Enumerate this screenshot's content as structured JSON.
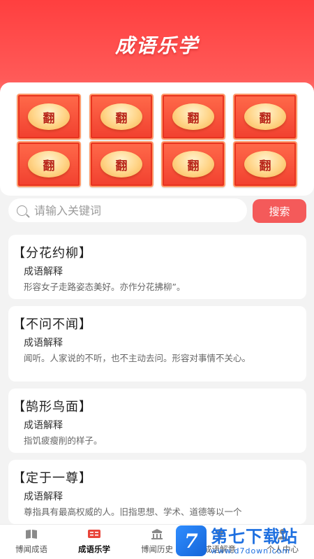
{
  "header": {
    "title": "成语乐学"
  },
  "tiles": [
    {
      "char": "翻"
    },
    {
      "char": "翻"
    },
    {
      "char": "翻"
    },
    {
      "char": "翻"
    },
    {
      "char": "翻"
    },
    {
      "char": "翻"
    },
    {
      "char": "翻"
    },
    {
      "char": "翻"
    }
  ],
  "search": {
    "placeholder": "请输入关键词",
    "value": "",
    "button_label": "搜索"
  },
  "cards": [
    {
      "title": "【分花约柳】",
      "subtitle": "成语解释",
      "desc": "形容女子走路姿态美好。亦作分花拂柳”。"
    },
    {
      "title": "【不问不闻】",
      "subtitle": "成语解释",
      "desc": "闻听。人家说的不听，也不主动去问。形容对事情不关心。"
    },
    {
      "title": "【鹄形鸟面】",
      "subtitle": "成语解释",
      "desc": "指饥疲瘦削的样子。"
    },
    {
      "title": "【定于一尊】",
      "subtitle": "成语解释",
      "desc": "尊指具有最高权威的人。旧指思想、学术、道德等以一个"
    }
  ],
  "nav": {
    "items": [
      {
        "label": "博闻成语",
        "icon": "book-icon",
        "active": false
      },
      {
        "label": "成语乐学",
        "icon": "cards-icon",
        "active": true
      },
      {
        "label": "博闻历史",
        "icon": "pavilion-icon",
        "active": false
      },
      {
        "label": "成语解意",
        "icon": "lightbulb-icon",
        "active": false
      },
      {
        "label": "个人中心",
        "icon": "user-icon",
        "active": false
      }
    ]
  },
  "watermark": {
    "badge": "7",
    "title": "第七下载站",
    "url": "www.d7down.com"
  },
  "colors": {
    "accent": "#f45a5a",
    "header_red": "#ff3f3f",
    "tile_red": "#f1402f",
    "tile_gold": "#ffd487"
  }
}
